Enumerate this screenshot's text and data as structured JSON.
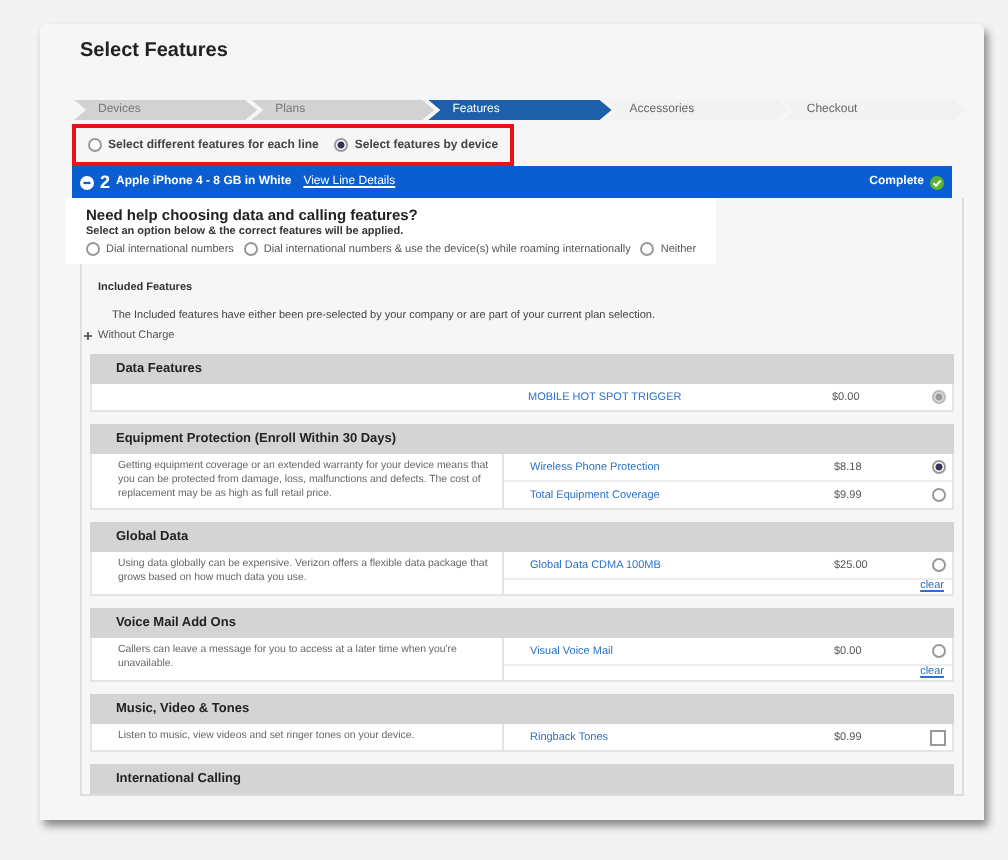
{
  "page": {
    "title": "Select Features"
  },
  "steps": [
    {
      "label": "Devices",
      "completed": true,
      "selected": false
    },
    {
      "label": "Plans",
      "completed": true,
      "selected": false
    },
    {
      "label": "Features",
      "completed": false,
      "selected": true
    },
    {
      "label": "Accessories",
      "completed": false,
      "selected": false
    },
    {
      "label": "Checkout",
      "completed": false,
      "selected": false
    }
  ],
  "mode": {
    "highlighted": true,
    "options": [
      {
        "label": "Select different features for each line",
        "selected": false
      },
      {
        "label": "Select features by device",
        "selected": true
      }
    ]
  },
  "line": {
    "number": "2",
    "device": "Apple iPhone 4 - 8 GB in White",
    "link": "View Line Details",
    "status": "Complete",
    "complete": true
  },
  "help": {
    "highlighted": true,
    "heading": "Need help choosing data and calling features?",
    "subheading": "Select an option below & the correct features will be applied.",
    "options": [
      {
        "label": "Dial international numbers",
        "selected": false
      },
      {
        "label": "Dial international numbers & use the device(s) while roaming internationally",
        "selected": false
      },
      {
        "label": "Neither",
        "selected": false
      }
    ]
  },
  "included": {
    "heading": "Included Features",
    "note": "The Included features have either been pre-selected by your company or are part of your current plan selection.",
    "toggle": "Without Charge",
    "expanded": false
  },
  "sections": [
    {
      "title": "Data Features",
      "options": [
        {
          "name": "MOBILE HOT SPOT TRIGGER",
          "price": "$0.00",
          "kind": "radio",
          "selected": true,
          "disabled": true
        }
      ]
    },
    {
      "title": "Equipment Protection (Enroll Within 30 Days)",
      "description": "Getting equipment coverage or an extended warranty for your device means that you can be protected from damage, loss, malfunctions and defects. The cost of replacement may be as high as full retail price.",
      "options": [
        {
          "name": "Wireless Phone Protection",
          "price": "$8.18",
          "kind": "radio",
          "selected": true,
          "disabled": false
        },
        {
          "name": "Total Equipment Coverage",
          "price": "$9.99",
          "kind": "radio",
          "selected": false,
          "disabled": false
        }
      ]
    },
    {
      "title": "Global Data",
      "description": "Using data globally can be expensive. Verizon offers a flexible data package that grows based on how much data you use.",
      "options": [
        {
          "name": "Global Data CDMA 100MB",
          "price": "$25.00",
          "kind": "radio",
          "selected": false,
          "disabled": false
        }
      ],
      "clear": "clear"
    },
    {
      "title": "Voice Mail Add Ons",
      "description": "Callers can leave a message for you to access at a later time when you're unavailable.",
      "options": [
        {
          "name": "Visual Voice Mail",
          "price": "$0.00",
          "kind": "radio",
          "selected": false,
          "disabled": false
        }
      ],
      "clear": "clear"
    },
    {
      "title": "Music, Video & Tones",
      "description": "Listen to music, view videos and set ringer tones on your device.",
      "options": [
        {
          "name": "Ringback Tones",
          "price": "$0.99",
          "kind": "checkbox",
          "selected": false,
          "disabled": false
        }
      ]
    },
    {
      "title": "International Calling"
    }
  ]
}
